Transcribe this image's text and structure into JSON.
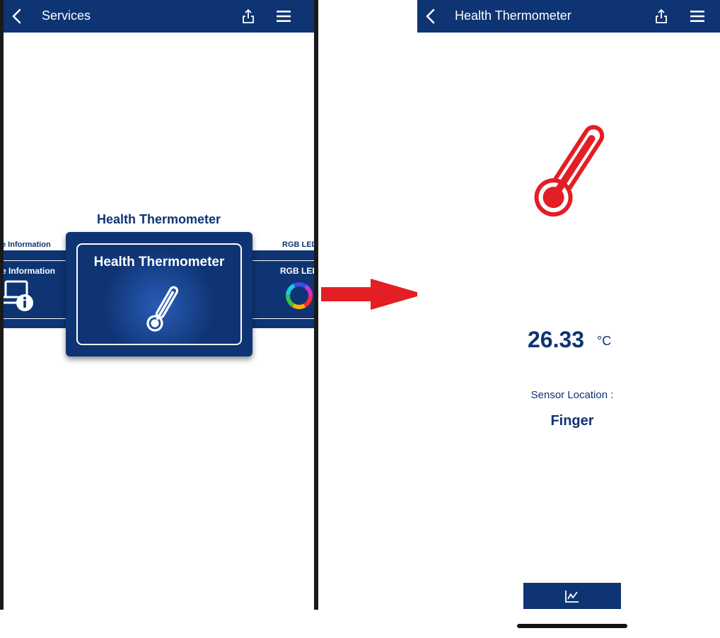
{
  "left_screen": {
    "nav": {
      "title": "Services",
      "back_icon": "chevron-left-icon",
      "share_icon": "share-icon",
      "menu_icon": "hamburger-menu-icon"
    },
    "carousel": {
      "heading": "Health Thermometer",
      "left_item": {
        "small_label": "e Information",
        "label": "e Information",
        "icon": "device-info-icon"
      },
      "center_item": {
        "label": "Health Thermometer",
        "icon": "thermometer-icon"
      },
      "right_item": {
        "small_label": "RGB LED",
        "label": "RGB LED",
        "icon": "rgb-color-wheel-icon"
      }
    }
  },
  "transition_arrow": {
    "color": "#e31e24"
  },
  "right_screen": {
    "nav": {
      "title": "Health Thermometer",
      "back_icon": "chevron-left-icon",
      "share_icon": "share-icon",
      "menu_icon": "hamburger-menu-icon"
    },
    "temperature": {
      "value": "26.33",
      "unit": "°C"
    },
    "sensor_location": {
      "label": "Sensor Location :",
      "value": "Finger"
    },
    "chart_button": {
      "icon": "line-chart-icon"
    },
    "thermometer_color": "#e31e24"
  },
  "colors": {
    "brand_navy": "#0e3474",
    "accent_red": "#e31e24",
    "white": "#ffffff"
  }
}
